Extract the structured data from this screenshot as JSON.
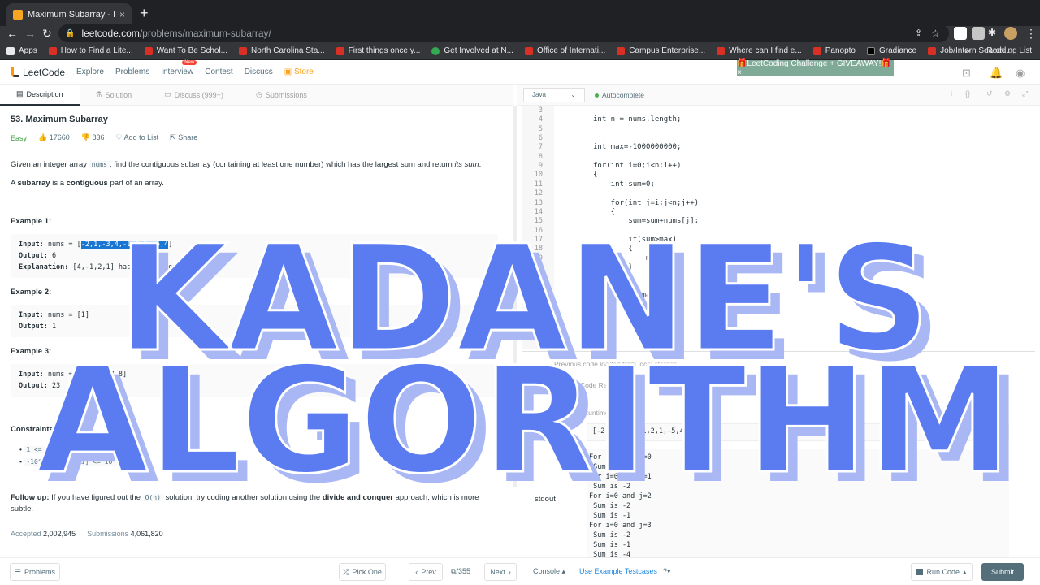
{
  "browser": {
    "tab_title": "Maximum Subarray - LeetCode",
    "tab_close": "×",
    "new_tab": "+",
    "url_host": "leetcode.com",
    "url_path": "/problems/maximum-subarray/",
    "bookmarks": [
      "Apps",
      "How to Find a Lite...",
      "Want To Be Schol...",
      "North Carolina Sta...",
      "First things once y...",
      "Get Involved at N...",
      "Office of Internati...",
      "Campus Enterprise...",
      "Where can I find e...",
      "Panopto",
      "Gradiance",
      "Job/Intern Search..."
    ],
    "bookmarks_more": "»",
    "reading_list": "Reading List"
  },
  "lc_nav": {
    "logo": "LeetCode",
    "links": [
      "Explore",
      "Problems",
      "Interview",
      "Contest",
      "Discuss"
    ],
    "new_badge": "New",
    "store": "Store",
    "challenge_banner": "🎁LeetCoding Challenge + GIVEAWAY!🎁 ×"
  },
  "left_tabs": [
    {
      "icon": "▤",
      "label": "Description"
    },
    {
      "icon": "⚗",
      "label": "Solution"
    },
    {
      "icon": "▭",
      "label": "Discuss (999+)"
    },
    {
      "icon": "◷",
      "label": "Submissions"
    }
  ],
  "problem": {
    "title": "53. Maximum Subarray",
    "difficulty": "Easy",
    "likes": "17660",
    "dislikes": "836",
    "add_to_list": "Add to List",
    "share": "Share",
    "desc_pre": "Given an integer array ",
    "desc_code": "nums",
    "desc_mid": ", find the contiguous subarray (containing at least one number) which has the largest sum and return ",
    "desc_em": "its sum",
    "desc_end": ".",
    "sub_a": "A ",
    "sub_b": "subarray",
    "sub_c": " is a ",
    "sub_d": "contiguous",
    "sub_e": " part of an array.",
    "example1_h": "Example 1:",
    "example1_input_label": "Input:",
    "example1_input_pre": " nums = [",
    "example1_input_hl": "-2,1,-3,4,-1,2,1,-5,4",
    "example1_input_post": "]",
    "example1_output_label": "Output:",
    "example1_output": " 6",
    "example1_expl_label": "Explanation:",
    "example1_expl": " [4,-1,2,1] has the largest sum = 6.",
    "example2_h": "Example 2:",
    "example2_input_label": "Input:",
    "example2_input": " nums = [1]",
    "example2_output_label": "Output:",
    "example2_output": " 1",
    "example3_h": "Example 3:",
    "example3_input_label": "Input:",
    "example3_input": " nums = [5,4,-1,7,8]",
    "example3_output_label": "Output:",
    "example3_output": " 23",
    "constraints_h": "Constraints:",
    "constraint1": "1 <= nums.length <= 3 * 10^4",
    "constraint2": "-10^5 <= nums[i] <= 10^5",
    "followup_label": "Follow up:",
    "followup_a": " If you have figured out the ",
    "followup_code": "O(n)",
    "followup_b": " solution, try coding another solution using the ",
    "followup_bold": "divide and conquer",
    "followup_c": " approach, which is more subtle.",
    "accepted_label": "Accepted",
    "accepted": "2,002,945",
    "submissions_label": "Submissions",
    "submissions": "4,061,820"
  },
  "editor": {
    "language": "Java",
    "autocomplete": "Autocomplete",
    "line_numbers": [
      "3",
      "4",
      "5",
      "6",
      "7",
      "8",
      "9",
      "10",
      "11",
      "12",
      "13",
      "14",
      "15",
      "16",
      "17",
      "18",
      "19",
      "20",
      "21",
      "22",
      "23",
      "24",
      "25",
      "26"
    ],
    "lines": [
      "",
      "int n = nums.length;",
      "",
      "",
      "int max=-1000000000;",
      "",
      "for(int i=0;i<n;i++)",
      "{",
      "    int sum=0;",
      "",
      "    for(int j=i;j<n;j++)",
      "    {",
      "        sum=sum+nums[j];",
      "",
      "        if(sum>max)",
      "        {",
      "            max=sum;",
      "        }",
      "    }",
      "",
      "    return max;",
      "",
      "}",
      ""
    ]
  },
  "console": {
    "prev_msg": "Previous code loaded from local storage",
    "run_label": "Run Code Result",
    "tab_input": "Input",
    "tab_runtime": "Runtime",
    "input_value": "[-2,1,-3,4,-1,2,1,-5,4]",
    "stdout_label": "stdout",
    "stdout": "For i=0 and j=0\n Sum is -2\nFor i=0 and j=1\n Sum is -2\nFor i=0 and j=2\n Sum is -2\n Sum is -1\nFor i=0 and j=3\n Sum is -2\n Sum is -1\n Sum is -4"
  },
  "bottom": {
    "problems": "Problems",
    "pick_one": "Pick One",
    "prev": "Prev",
    "page": "/355",
    "next": "Next",
    "console": "Console",
    "use_example": "Use Example Testcases",
    "run_code": "Run Code",
    "submit": "Submit"
  },
  "overlay": {
    "line1": "KADANE'S",
    "line2": "ALGORITHM",
    "color": "#5b7cf0",
    "shadow_color": "#a9b8f5"
  }
}
